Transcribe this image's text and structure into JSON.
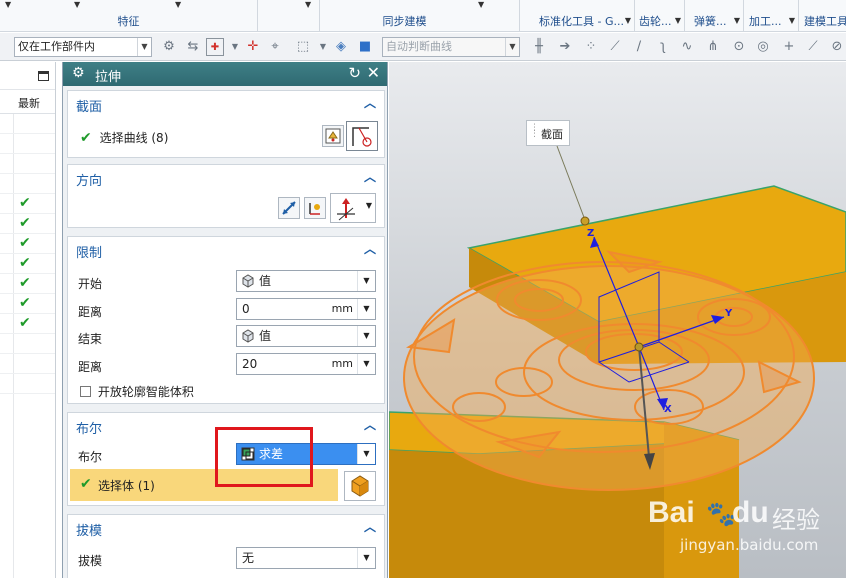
{
  "ribbon": {
    "groups": [
      "特征",
      "同步建模",
      "标准化工具 - G...",
      "齿轮...",
      "弹簧...",
      "加工...",
      "建模工具..."
    ]
  },
  "selection_bar": {
    "filter_value": "仅在工作部件内",
    "curve_rule_value": "自动判断曲线"
  },
  "navigator": {
    "column_header": "最新",
    "checked_rows": 7
  },
  "dialog": {
    "title": "拉伸",
    "sections": {
      "section": {
        "title": "截面",
        "select_curve": "选择曲线 (8)"
      },
      "direction": {
        "title": "方向"
      },
      "limits": {
        "title": "限制",
        "start_label": "开始",
        "start_value": "值",
        "distance1_label": "距离",
        "distance1_value": "0",
        "distance1_unit": "mm",
        "end_label": "结束",
        "end_value": "值",
        "distance2_label": "距离",
        "distance2_value": "20",
        "distance2_unit": "mm",
        "open_profile": "开放轮廓智能体积"
      },
      "boolean": {
        "title": "布尔",
        "label": "布尔",
        "value": "求差",
        "select_body": "选择体 (1)"
      },
      "draft": {
        "title": "拔模",
        "label": "拔模",
        "value": "无"
      }
    }
  },
  "viewport": {
    "callout": "截面",
    "axis_x": "X",
    "axis_y": "Y",
    "axis_z": "Z"
  },
  "watermark": {
    "brand": "Bai",
    "brand2": "du",
    "cn": "经验",
    "url": "jingyan.baidu.com"
  },
  "colors": {
    "dialog_title": "#2f6a72",
    "section_title": "#1f5fa6",
    "solid_fill": "#e8a90f",
    "sketch_curve": "#f08a2e",
    "selected_item": "#3b8ff0",
    "highlight_box": "#e0171d",
    "check_green": "#1f9a2a"
  }
}
